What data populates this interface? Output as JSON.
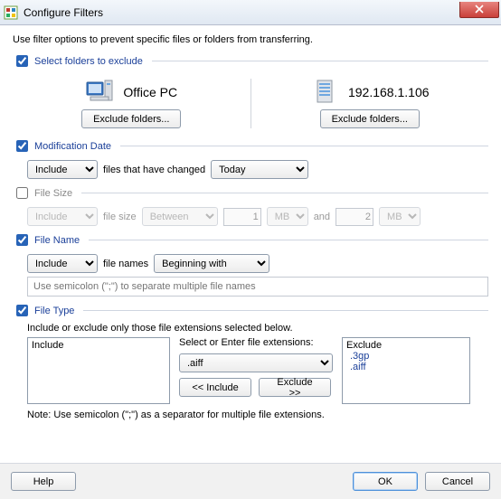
{
  "window": {
    "title": "Configure Filters"
  },
  "intro": "Use filter options to prevent specific files or folders from transferring.",
  "folders": {
    "checked": true,
    "label": "Select folders to exclude",
    "left": {
      "name": "Office PC",
      "button": "Exclude folders..."
    },
    "right": {
      "name": "192.168.1.106",
      "button": "Exclude folders..."
    }
  },
  "modDate": {
    "checked": true,
    "label": "Modification Date",
    "mode": "Include",
    "mid": "files that have changed",
    "range": "Today"
  },
  "fileSize": {
    "checked": false,
    "label": "File Size",
    "mode": "Include",
    "mid": "file size",
    "op": "Between",
    "v1": "1",
    "u1": "MB",
    "and": "and",
    "v2": "2",
    "u2": "MB"
  },
  "fileName": {
    "checked": true,
    "label": "File Name",
    "mode": "Include",
    "mid": "file names",
    "match": "Beginning with",
    "hint": "Use semicolon (\";\") to separate multiple file names"
  },
  "fileType": {
    "checked": true,
    "label": "File Type",
    "instr": "Include or exclude only those file extensions selected below.",
    "includeHeader": "Include",
    "excludeHeader": "Exclude",
    "selectLabel": "Select or Enter file extensions:",
    "ext": ".aiff",
    "btnInc": "<< Include",
    "btnExc": "Exclude >>",
    "excluded": [
      ".3gp",
      ".aiff"
    ],
    "note": "Note: Use semicolon (\";\") as a separator for multiple file extensions."
  },
  "footer": {
    "help": "Help",
    "ok": "OK",
    "cancel": "Cancel"
  }
}
